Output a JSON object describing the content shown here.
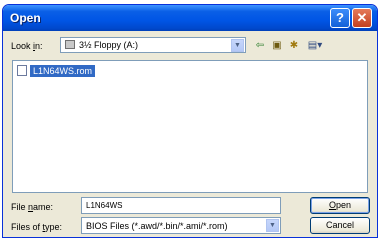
{
  "window": {
    "title": "Open"
  },
  "titlebar": {
    "help_glyph": "?",
    "close_glyph": "✕"
  },
  "lookin": {
    "label_prefix": "Look ",
    "label_accel": "i",
    "label_suffix": "n:",
    "value": "3½ Floppy (A:)"
  },
  "toolbar": {
    "back_glyph": "⇦",
    "upfolder_glyph": "▣",
    "newfolder_glyph": "✱",
    "views_glyph": "▤▾"
  },
  "files": [
    {
      "name": "L1N64WS.rom"
    }
  ],
  "filename": {
    "label_prefix": "File ",
    "label_accel": "n",
    "label_suffix": "ame:",
    "value": "L1N64WS"
  },
  "filetype": {
    "label_prefix": "Files of ",
    "label_accel": "t",
    "label_suffix": "ype:",
    "value": "BIOS Files (*.awd/*.bin/*.ami/*.rom)"
  },
  "buttons": {
    "open_accel": "O",
    "open_rest": "pen",
    "cancel": "Cancel"
  }
}
